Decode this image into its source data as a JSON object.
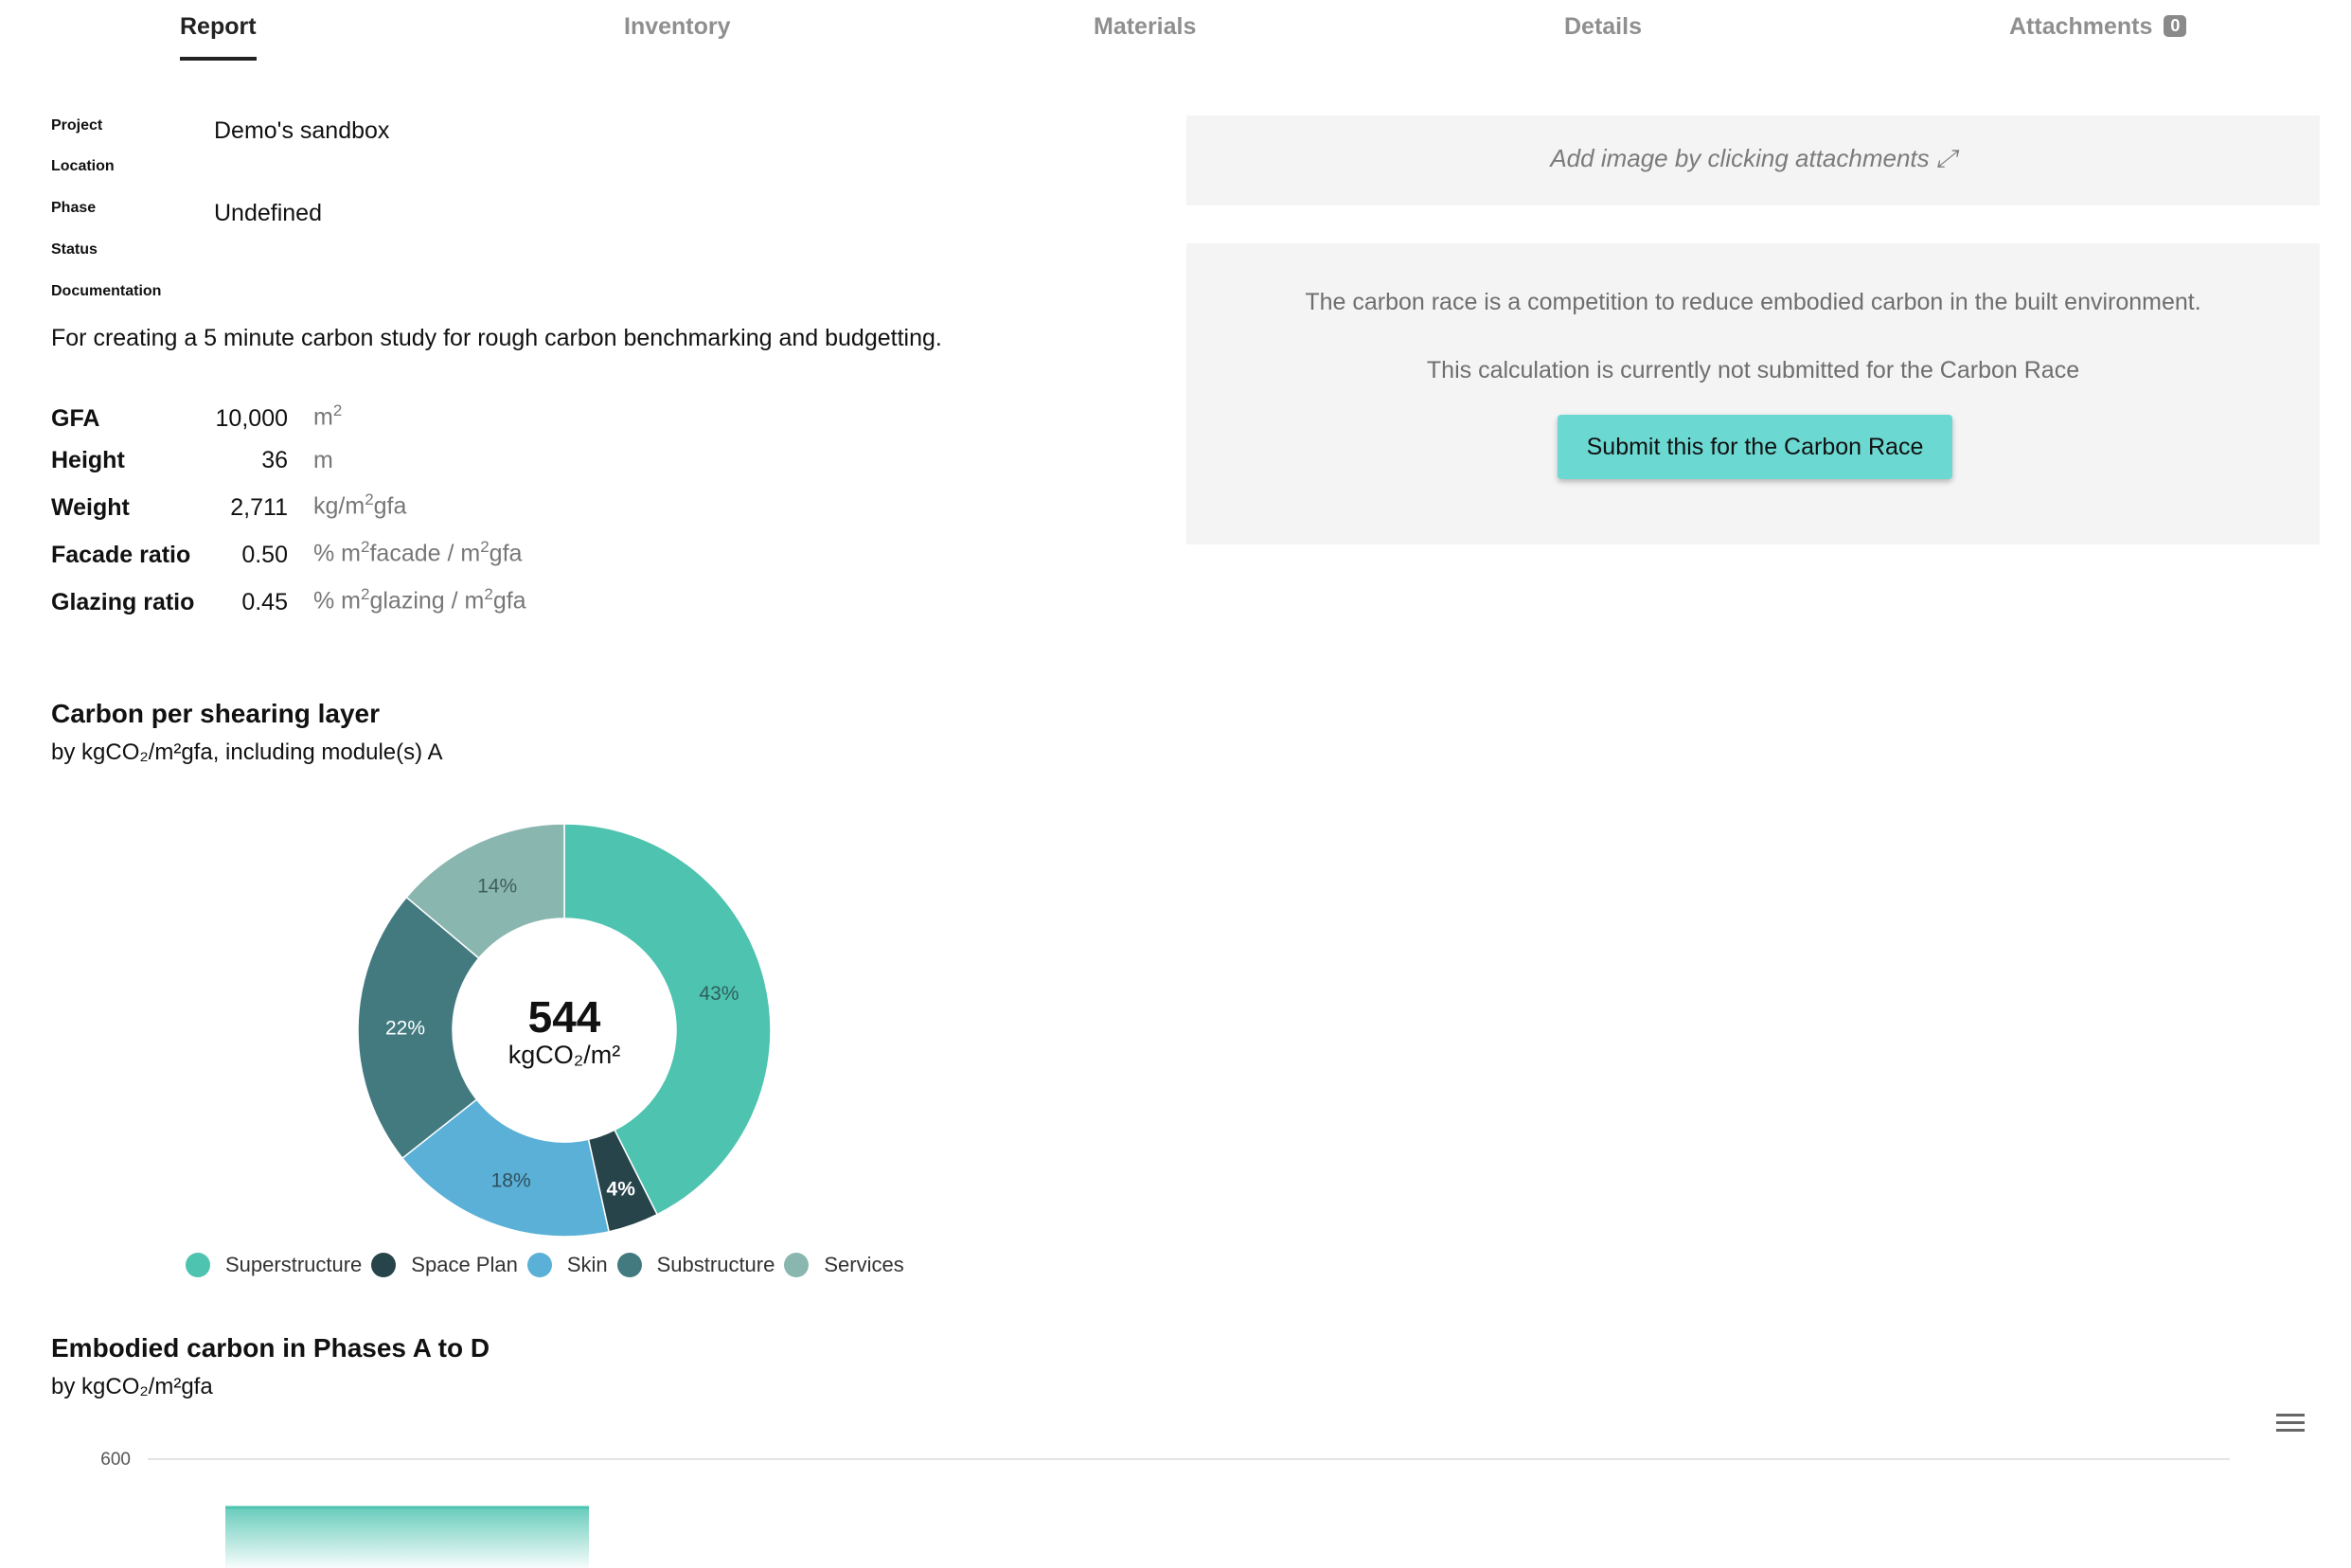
{
  "tabs": [
    {
      "label": "Report",
      "active": true
    },
    {
      "label": "Inventory",
      "active": false
    },
    {
      "label": "Materials",
      "active": false
    },
    {
      "label": "Details",
      "active": false
    },
    {
      "label": "Attachments",
      "active": false,
      "badge": "0"
    }
  ],
  "info": {
    "project_label": "Project",
    "project_value": "Demo's sandbox",
    "location_label": "Location",
    "location_value": "",
    "phase_label": "Phase",
    "phase_value": "Undefined",
    "status_label": "Status",
    "status_value": "",
    "documentation_label": "Documentation",
    "documentation_text": "For creating a 5 minute carbon study for rough carbon benchmarking and budgetting."
  },
  "metrics": [
    {
      "label": "GFA",
      "value": "10,000",
      "unit_pre": "m",
      "unit_sup": "2",
      "unit_post": ""
    },
    {
      "label": "Height",
      "value": "36",
      "unit_pre": "m",
      "unit_sup": "",
      "unit_post": ""
    },
    {
      "label": "Weight",
      "value": "2,711",
      "unit_pre": "kg/m",
      "unit_sup": "2",
      "unit_post": "gfa"
    },
    {
      "label": "Facade ratio",
      "value": "0.50",
      "unit_pre": "% m",
      "unit_sup": "2",
      "unit_post": "facade / m",
      "unit_sup2": "2",
      "unit_post2": "gfa"
    },
    {
      "label": "Glazing ratio",
      "value": "0.45",
      "unit_pre": "% m",
      "unit_sup": "2",
      "unit_post": "glazing / m",
      "unit_sup2": "2",
      "unit_post2": "gfa"
    }
  ],
  "image_panel": {
    "hint": "Add image by clicking attachments ⤢"
  },
  "carbon_race": {
    "description": "The carbon race is a competition to reduce embodied carbon in the built environment.",
    "status": "This calculation is currently not submitted for the Carbon Race",
    "button_label": "Submit this for the Carbon Race"
  },
  "chart_data": [
    {
      "type": "pie",
      "title": "Carbon per shearing layer",
      "subtitle": "by kgCO₂/m²gfa, including module(s) A",
      "center_value": "544",
      "center_unit": "kgCO₂/m²",
      "legend_placement": "bottom",
      "slices": [
        {
          "name": "Superstructure",
          "value": 43,
          "label": "43%",
          "color": "#4dc3b0"
        },
        {
          "name": "Space Plan",
          "value": 4,
          "label": "4%",
          "color": "#27444a"
        },
        {
          "name": "Skin",
          "value": 18,
          "label": "18%",
          "color": "#5ab0d6"
        },
        {
          "name": "Substructure",
          "value": 22,
          "label": "22%",
          "color": "#427a80"
        },
        {
          "name": "Services",
          "value": 14,
          "label": "14%",
          "color": "#8ab6b0"
        }
      ]
    },
    {
      "type": "bar",
      "title": "Embodied carbon in Phases A to D",
      "subtitle": "by kgCO₂/m²gfa",
      "y_ticks": [
        "600"
      ],
      "ylim": [
        0,
        600
      ],
      "values": [
        544
      ],
      "grid": true,
      "color": "#4dc3b0"
    }
  ]
}
